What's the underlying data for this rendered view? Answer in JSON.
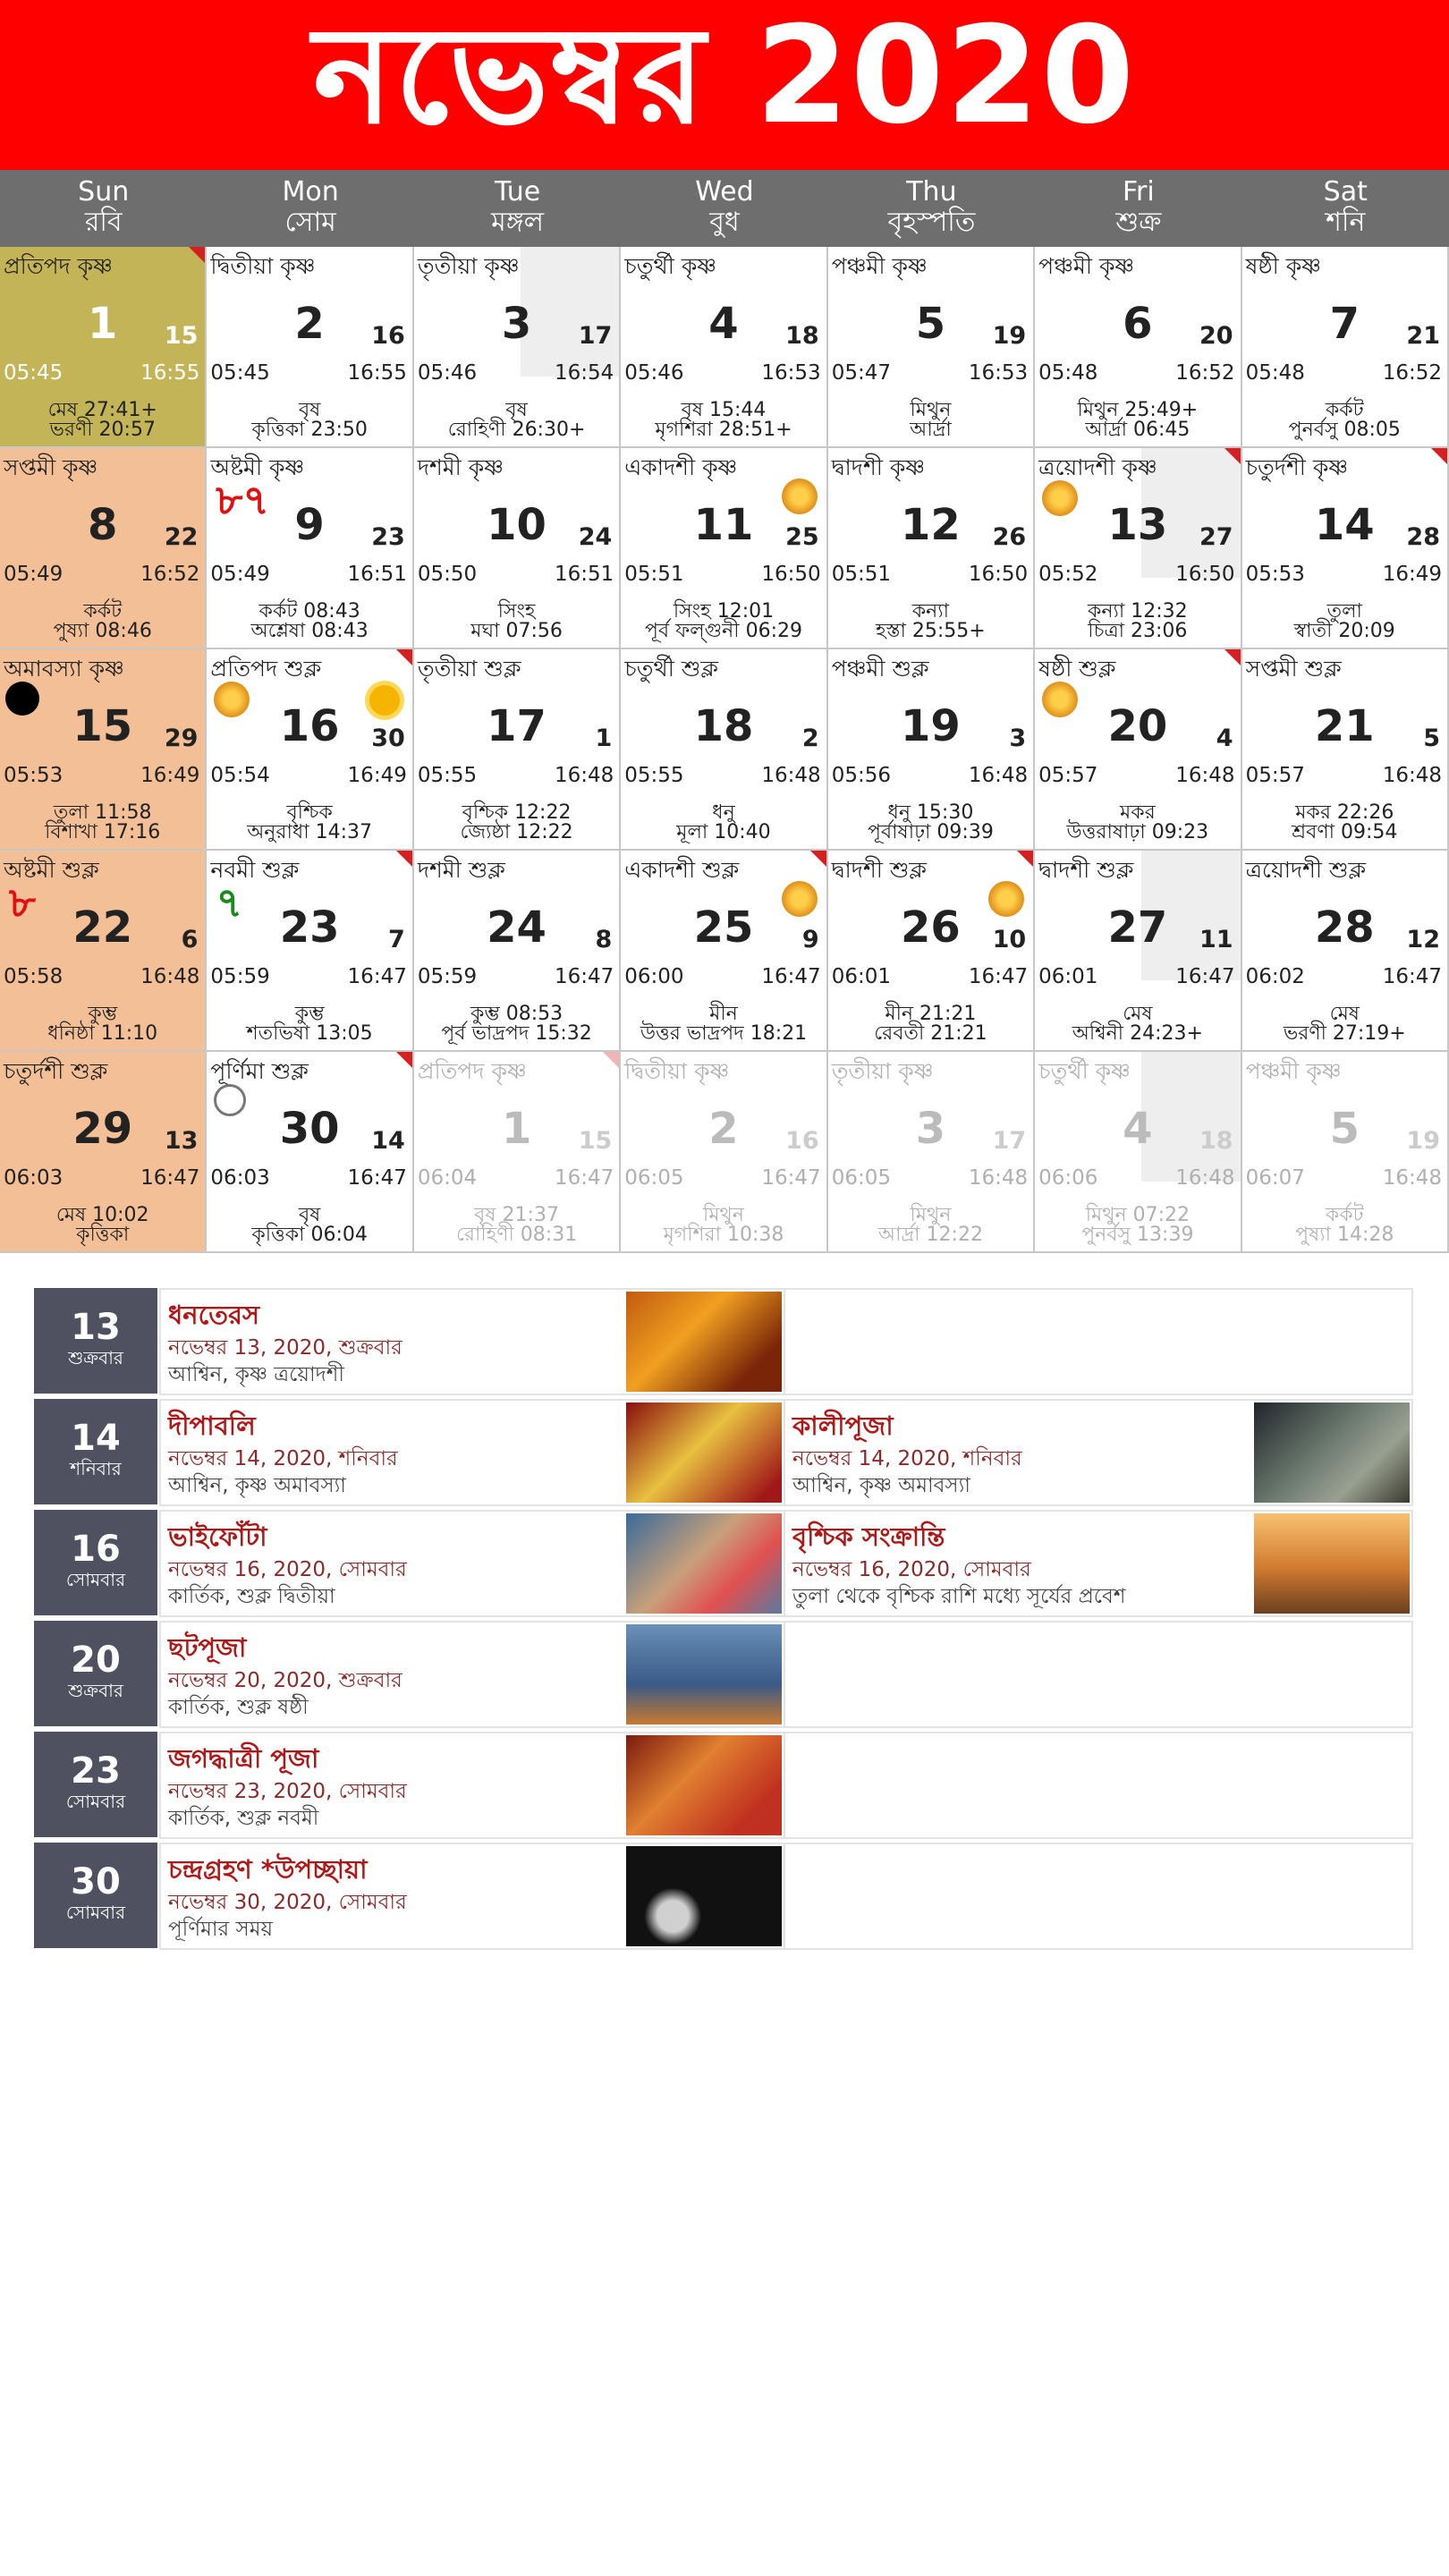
{
  "header": {
    "title": "নভেম্বর 2020"
  },
  "weekdays": [
    {
      "en": "Sun",
      "bn": "রবি"
    },
    {
      "en": "Mon",
      "bn": "সোম"
    },
    {
      "en": "Tue",
      "bn": "মঙ্গল"
    },
    {
      "en": "Wed",
      "bn": "বুধ"
    },
    {
      "en": "Thu",
      "bn": "বৃহস্পতি"
    },
    {
      "en": "Fri",
      "bn": "শুক্র"
    },
    {
      "en": "Sat",
      "bn": "শনি"
    }
  ],
  "cells": [
    {
      "tithi": "প্রতিপদ কৃষ্ণ",
      "day": "1",
      "bday": "15",
      "rise": "05:45",
      "set": "16:55",
      "rashi": "মেষ 27:41+",
      "nak": "ভরণী 20:57",
      "cls": "today",
      "corner": true
    },
    {
      "tithi": "দ্বিতীয়া কৃষ্ণ",
      "day": "2",
      "bday": "16",
      "rise": "05:45",
      "set": "16:55",
      "rashi": "বৃষ",
      "nak": "কৃত্তিকা 23:50"
    },
    {
      "tithi": "তৃতীয়া কৃষ্ণ",
      "day": "3",
      "bday": "17",
      "rise": "05:46",
      "set": "16:54",
      "rashi": "বৃষ",
      "nak": "রোহিণী 26:30+",
      "shade": true
    },
    {
      "tithi": "চতুর্থী কৃষ্ণ",
      "day": "4",
      "bday": "18",
      "rise": "05:46",
      "set": "16:53",
      "rashi": "বৃষ 15:44",
      "nak": "মৃগশিরা 28:51+"
    },
    {
      "tithi": "পঞ্চমী কৃষ্ণ",
      "day": "5",
      "bday": "19",
      "rise": "05:47",
      "set": "16:53",
      "rashi": "মিথুন",
      "nak": "আর্দ্রা"
    },
    {
      "tithi": "পঞ্চমী কৃষ্ণ",
      "day": "6",
      "bday": "20",
      "rise": "05:48",
      "set": "16:52",
      "rashi": "মিথুন 25:49+",
      "nak": "আর্দ্রা 06:45"
    },
    {
      "tithi": "ষষ্ঠী কৃষ্ণ",
      "day": "7",
      "bday": "21",
      "rise": "05:48",
      "set": "16:52",
      "rashi": "কর্কট",
      "nak": "পুনর্বসু 08:05"
    },
    {
      "tithi": "সপ্তমী কৃষ্ণ",
      "day": "8",
      "bday": "22",
      "rise": "05:49",
      "set": "16:52",
      "rashi": "কর্কট",
      "nak": "পুষ্যা 08:46",
      "cls": "sunday"
    },
    {
      "tithi": "অষ্টমী কৃষ্ণ",
      "day": "9",
      "bday": "23",
      "rise": "05:49",
      "set": "16:51",
      "rashi": "কর্কট 08:43",
      "nak": "অশ্লেষা 08:43",
      "mark": "৮৭"
    },
    {
      "tithi": "দশমী কৃষ্ণ",
      "day": "10",
      "bday": "24",
      "rise": "05:50",
      "set": "16:51",
      "rashi": "সিংহ",
      "nak": "মঘা 07:56"
    },
    {
      "tithi": "একাদশী কৃষ্ণ",
      "day": "11",
      "bday": "25",
      "rise": "05:51",
      "set": "16:50",
      "rashi": "সিংহ 12:01",
      "nak": "পূর্ব ফল্গুনী 06:29",
      "deity": true
    },
    {
      "tithi": "দ্বাদশী কৃষ্ণ",
      "day": "12",
      "bday": "26",
      "rise": "05:51",
      "set": "16:50",
      "rashi": "কন্যা",
      "nak": "হস্তা 25:55+"
    },
    {
      "tithi": "ত্রয়োদশী কৃষ্ণ",
      "day": "13",
      "bday": "27",
      "rise": "05:52",
      "set": "16:50",
      "rashi": "কন্যা 12:32",
      "nak": "চিত্রা 23:06",
      "corner": true,
      "shade": true,
      "deityLeft": true
    },
    {
      "tithi": "চতুর্দশী কৃষ্ণ",
      "day": "14",
      "bday": "28",
      "rise": "05:53",
      "set": "16:49",
      "rashi": "তুলা",
      "nak": "স্বাতী 20:09",
      "corner": true
    },
    {
      "tithi": "অমাবস্যা কৃষ্ণ",
      "day": "15",
      "bday": "29",
      "rise": "05:53",
      "set": "16:49",
      "rashi": "তুলা 11:58",
      "nak": "বিশাখা 17:16",
      "cls": "sunday",
      "newmoon": true
    },
    {
      "tithi": "প্রতিপদ শুক্ল",
      "day": "16",
      "bday": "30",
      "rise": "05:54",
      "set": "16:49",
      "rashi": "বৃশ্চিক",
      "nak": "অনুরাধা 14:37",
      "corner": true,
      "sun": true,
      "deityLeft": true
    },
    {
      "tithi": "তৃতীয়া শুক্ল",
      "day": "17",
      "bday": "1",
      "rise": "05:55",
      "set": "16:48",
      "rashi": "বৃশ্চিক 12:22",
      "nak": "জ্যেষ্ঠা 12:22"
    },
    {
      "tithi": "চতুর্থী শুক্ল",
      "day": "18",
      "bday": "2",
      "rise": "05:55",
      "set": "16:48",
      "rashi": "ধনু",
      "nak": "মূলা 10:40"
    },
    {
      "tithi": "পঞ্চমী শুক্ল",
      "day": "19",
      "bday": "3",
      "rise": "05:56",
      "set": "16:48",
      "rashi": "ধনু 15:30",
      "nak": "পূর্বাষাঢ়া 09:39"
    },
    {
      "tithi": "ষষ্ঠী শুক্ল",
      "day": "20",
      "bday": "4",
      "rise": "05:57",
      "set": "16:48",
      "rashi": "মকর",
      "nak": "উত্তরাষাঢ়া 09:23",
      "corner": true,
      "deityLeft": true
    },
    {
      "tithi": "সপ্তমী শুক্ল",
      "day": "21",
      "bday": "5",
      "rise": "05:57",
      "set": "16:48",
      "rashi": "মকর 22:26",
      "nak": "শ্রবণা 09:54"
    },
    {
      "tithi": "অষ্টমী শুক্ল",
      "day": "22",
      "bday": "6",
      "rise": "05:58",
      "set": "16:48",
      "rashi": "কুম্ভ",
      "nak": "ধনিষ্ঠা 11:10",
      "cls": "sunday",
      "mark": "৮"
    },
    {
      "tithi": "নবমী শুক্ল",
      "day": "23",
      "bday": "7",
      "rise": "05:59",
      "set": "16:47",
      "rashi": "কুম্ভ",
      "nak": "শতভিষা 13:05",
      "corner": true,
      "markGreen": "৭"
    },
    {
      "tithi": "দশমী শুক্ল",
      "day": "24",
      "bday": "8",
      "rise": "05:59",
      "set": "16:47",
      "rashi": "কুম্ভ 08:53",
      "nak": "পূর্ব ভাদ্রপদ 15:32"
    },
    {
      "tithi": "একাদশী শুক্ল",
      "day": "25",
      "bday": "9",
      "rise": "06:00",
      "set": "16:47",
      "rashi": "মীন",
      "nak": "উত্তর ভাদ্রপদ 18:21",
      "corner": true,
      "deity": true
    },
    {
      "tithi": "দ্বাদশী শুক্ল",
      "day": "26",
      "bday": "10",
      "rise": "06:01",
      "set": "16:47",
      "rashi": "মীন 21:21",
      "nak": "রেবতী 21:21",
      "corner": true,
      "deity": true
    },
    {
      "tithi": "দ্বাদশী শুক্ল",
      "day": "27",
      "bday": "11",
      "rise": "06:01",
      "set": "16:47",
      "rashi": "মেষ",
      "nak": "অশ্বিনী 24:23+",
      "shade": true
    },
    {
      "tithi": "ত্রয়োদশী শুক্ল",
      "day": "28",
      "bday": "12",
      "rise": "06:02",
      "set": "16:47",
      "rashi": "মেষ",
      "nak": "ভরণী 27:19+"
    },
    {
      "tithi": "চতুর্দশী শুক্ল",
      "day": "29",
      "bday": "13",
      "rise": "06:03",
      "set": "16:47",
      "rashi": "মেষ 10:02",
      "nak": "কৃত্তিকা",
      "cls": "sunday"
    },
    {
      "tithi": "পূর্ণিমা শুক্ল",
      "day": "30",
      "bday": "14",
      "rise": "06:03",
      "set": "16:47",
      "rashi": "বৃষ",
      "nak": "কৃত্তিকা 06:04",
      "corner": true,
      "fullmoon": true
    },
    {
      "tithi": "প্রতিপদ কৃষ্ণ",
      "day": "1",
      "bday": "15",
      "rise": "06:04",
      "set": "16:47",
      "rashi": "বৃষ 21:37",
      "nak": "রোহিণী 08:31",
      "cls": "faded",
      "corner": true
    },
    {
      "tithi": "দ্বিতীয়া কৃষ্ণ",
      "day": "2",
      "bday": "16",
      "rise": "06:05",
      "set": "16:47",
      "rashi": "মিথুন",
      "nak": "মৃগশিরা 10:38",
      "cls": "faded"
    },
    {
      "tithi": "তৃতীয়া কৃষ্ণ",
      "day": "3",
      "bday": "17",
      "rise": "06:05",
      "set": "16:48",
      "rashi": "মিথুন",
      "nak": "আর্দ্রা 12:22",
      "cls": "faded"
    },
    {
      "tithi": "চতুর্থী কৃষ্ণ",
      "day": "4",
      "bday": "18",
      "rise": "06:06",
      "set": "16:48",
      "rashi": "মিথুন 07:22",
      "nak": "পুনর্বসু 13:39",
      "cls": "faded",
      "shade": true
    },
    {
      "tithi": "পঞ্চমী কৃষ্ণ",
      "day": "5",
      "bday": "19",
      "rise": "06:07",
      "set": "16:48",
      "rashi": "কর্কট",
      "nak": "পুষ্যা 14:28",
      "cls": "faded"
    }
  ],
  "festivals": [
    {
      "day": "13",
      "weekday": "শুক্রবার",
      "items": [
        {
          "name": "ধনতেরস",
          "date": "নভেম্বর 13, 2020, শুক্রবার",
          "sub": "আশ্বিন, কৃষ্ণ ত্রয়োদশী",
          "img": "durga"
        }
      ]
    },
    {
      "day": "14",
      "weekday": "শনিবার",
      "items": [
        {
          "name": "দীপাবলি",
          "date": "নভেম্বর 14, 2020, শনিবার",
          "sub": "আশ্বিন, কৃষ্ণ অমাবস্যা",
          "img": "diwali"
        },
        {
          "name": "কালীপূজা",
          "date": "নভেম্বর 14, 2020, শনিবার",
          "sub": "আশ্বিন, কৃষ্ণ অমাবস্যা",
          "img": "kali"
        }
      ]
    },
    {
      "day": "16",
      "weekday": "সোমবার",
      "items": [
        {
          "name": "ভাইফোঁটা",
          "date": "নভেম্বর 16, 2020, সোমবার",
          "sub": "কার্তিক, শুক্ল দ্বিতীয়া",
          "img": "bhai"
        },
        {
          "name": "বৃশ্চিক সংক্রান্তি",
          "date": "নভেম্বর 16, 2020, সোমবার",
          "sub": "তুলা থেকে বৃশ্চিক রাশি মধ্যে সূর্যের প্রবেশ",
          "img": "sun"
        }
      ]
    },
    {
      "day": "20",
      "weekday": "শুক্রবার",
      "items": [
        {
          "name": "ছটপূজা",
          "date": "নভেম্বর 20, 2020, শুক্রবার",
          "sub": "কার্তিক, শুক্ল ষষ্ঠী",
          "img": "chhath"
        }
      ]
    },
    {
      "day": "23",
      "weekday": "সোমবার",
      "items": [
        {
          "name": "জগদ্ধাত্রী পূজা",
          "date": "নভেম্বর 23, 2020, সোমবার",
          "sub": "কার্তিক, শুক্ল নবমী",
          "img": "jagad"
        }
      ]
    },
    {
      "day": "30",
      "weekday": "সোমবার",
      "items": [
        {
          "name": "চন্দ্রগ্রহণ *উপচ্ছায়া",
          "date": "নভেম্বর 30, 2020, সোমবার",
          "sub": "পূর্ণিমার সময়",
          "img": "eclipse"
        }
      ]
    }
  ],
  "colors": {
    "header": "#ff0000",
    "weekday_bar": "#6e6e6e",
    "today": "#c4b458",
    "sunday": "#f2bf96",
    "datebox": "#4f5060",
    "festival_name": "#b01818"
  }
}
